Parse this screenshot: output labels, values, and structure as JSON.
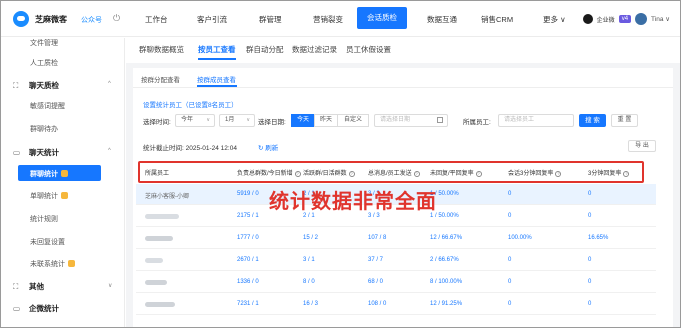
{
  "header": {
    "brand": "芝麻微客",
    "account": "公众号",
    "nav": [
      "工作台",
      "客户引流",
      "群管理",
      "营销裂变",
      "会话质检",
      "数据互通",
      "销售CRM",
      "更多 ∨"
    ],
    "active_nav_index": 4,
    "qiye_label": "企业微",
    "v_badge": "v4",
    "user_name": "Tina ∨"
  },
  "sidebar": {
    "items": [
      {
        "type": "item",
        "label": "文件管理"
      },
      {
        "type": "item",
        "label": "人工质检"
      },
      {
        "type": "group",
        "label": "聊天质检",
        "icon": "scan-icon",
        "chevron": "^"
      },
      {
        "type": "item",
        "label": "敏感词提醒"
      },
      {
        "type": "item",
        "label": "群聊待办"
      },
      {
        "type": "group",
        "label": "聊天统计",
        "icon": "chart-icon",
        "chevron": "^"
      },
      {
        "type": "active",
        "label": "群聊统计"
      },
      {
        "type": "item",
        "label": "单聊统计"
      },
      {
        "type": "item",
        "label": "统计规则"
      },
      {
        "type": "item",
        "label": "未回复设置"
      },
      {
        "type": "item",
        "label": "未联系统计"
      },
      {
        "type": "group",
        "label": "其他",
        "icon": "scan-icon",
        "chevron": "∨"
      },
      {
        "type": "group",
        "label": "企微统计",
        "icon": "chart-icon",
        "chevron": ""
      }
    ]
  },
  "tabs_main": [
    "群聊数据概览",
    "按员工查看",
    "群自动分配",
    "数据过滤记录",
    "员工休假设置"
  ],
  "tabs_main_active": 1,
  "tabs_sub": [
    "按群分配查看",
    "按群成员查看"
  ],
  "tabs_sub_active": 1,
  "filters": {
    "set_staff_link": "设置统计员工（已设置8名员工）",
    "time_label": "选择时间:",
    "year_value": "今年",
    "month_value": "1月",
    "date_label": "选择日期:",
    "date_options": [
      "今天",
      "昨天",
      "自定义"
    ],
    "date_active": 0,
    "date_placeholder": "请选择日期",
    "staff_label": "所属员工:",
    "staff_placeholder": "请选择员工",
    "search_button": "搜 索",
    "reset_button": "重 置",
    "deadline_text": "统计截止时间: 2025-01-24 12:04",
    "refresh_text": "刷新",
    "export_button": "导 出"
  },
  "table": {
    "columns": [
      "所属员工",
      "负责总群数/今日新增",
      "活跃群/日活群数",
      "总消息/员工发送",
      "未回复/平回复率",
      "会话3分钟回复率",
      "3分钟回复率"
    ],
    "rows": [
      {
        "staff": "芝麻小客服-小卿",
        "c1": "5919 / 0",
        "c2": "2 / 1",
        "c3": "3 / 3",
        "c4": "1 / 50.00%",
        "c5": "0",
        "c6": "0"
      },
      {
        "staff": "",
        "c1": "2175 / 1",
        "c2": "2 / 1",
        "c3": "3 / 3",
        "c4": "1 / 50.00%",
        "c5": "0",
        "c6": "0"
      },
      {
        "staff": "",
        "c1": "1777 / 0",
        "c2": "15 / 2",
        "c3": "107 / 8",
        "c4": "12 / 66.67%",
        "c5": "100.00%",
        "c6": "16.65%"
      },
      {
        "staff": "",
        "c1": "2670 / 1",
        "c2": "3 / 1",
        "c3": "37 / 7",
        "c4": "2 / 66.67%",
        "c5": "0",
        "c6": "0"
      },
      {
        "staff": "",
        "c1": "1336 / 0",
        "c2": "8 / 0",
        "c3": "68 / 0",
        "c4": "8 / 100.00%",
        "c5": "0",
        "c6": "0"
      },
      {
        "staff": "",
        "c1": "7231 / 1",
        "c2": "16 / 3",
        "c3": "108 / 0",
        "c4": "12 / 91.25%",
        "c5": "0",
        "c6": "0"
      }
    ]
  },
  "overlay_text": "统计数据非常全面"
}
